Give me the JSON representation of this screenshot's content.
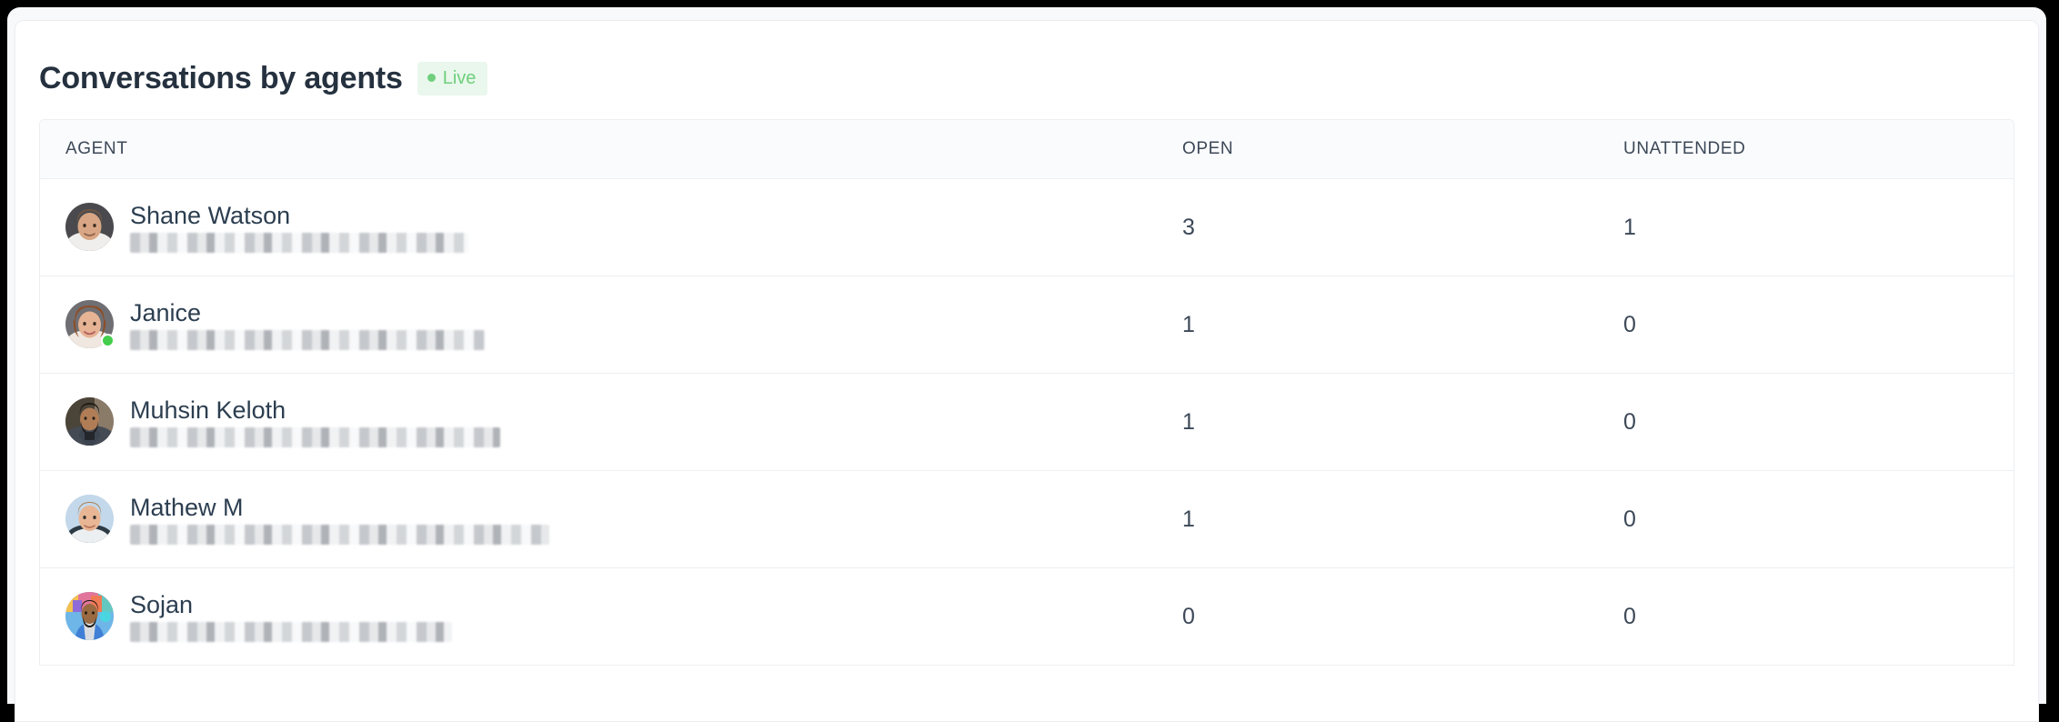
{
  "card": {
    "title": "Conversations by agents",
    "badge": {
      "label": "Live",
      "dot_icon": "live-dot-icon",
      "color": "#6fcf7d",
      "background": "#e9f7ec"
    }
  },
  "table": {
    "columns": [
      {
        "key": "agent",
        "label": "AGENT"
      },
      {
        "key": "open",
        "label": "OPEN"
      },
      {
        "key": "unattended",
        "label": "UNATTENDED"
      }
    ],
    "rows": [
      {
        "name": "Shane Watson",
        "email": "█████████████████████",
        "email_redacted": true,
        "online": false,
        "avatar_icon": "avatar-shane-watson",
        "open": "3",
        "unattended": "1"
      },
      {
        "name": "Janice",
        "email": "██████████████████████",
        "email_redacted": true,
        "online": true,
        "avatar_icon": "avatar-janice",
        "open": "1",
        "unattended": "0"
      },
      {
        "name": "Muhsin Keloth",
        "email": "███████████████████████",
        "email_redacted": true,
        "online": false,
        "avatar_icon": "avatar-muhsin-keloth",
        "open": "1",
        "unattended": "0"
      },
      {
        "name": "Mathew M",
        "email": "██████████████████████████",
        "email_redacted": true,
        "online": false,
        "avatar_icon": "avatar-mathew-m",
        "open": "1",
        "unattended": "0"
      },
      {
        "name": "Sojan",
        "email": "████████████████████",
        "email_redacted": true,
        "online": false,
        "avatar_icon": "avatar-sojan",
        "open": "0",
        "unattended": "0"
      }
    ]
  },
  "colors": {
    "title": "#25313f",
    "text": "#3c4858",
    "border": "#edeff2",
    "header_bg": "#fafbfc",
    "presence_online": "#44ce4b"
  }
}
